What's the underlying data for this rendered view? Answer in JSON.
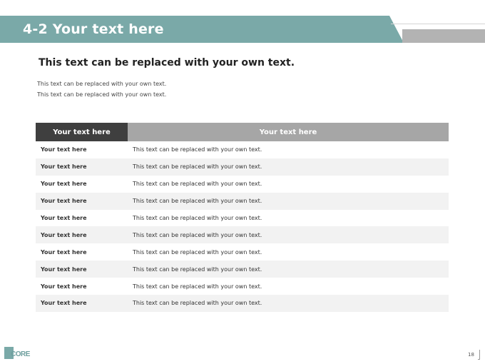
{
  "header": {
    "title": "4-2 Your text here"
  },
  "content": {
    "subtitle": "This text can be replaced with your own text.",
    "body_lines": [
      "This text can be replaced with your own text.",
      "This text can be replaced with your own text."
    ]
  },
  "table": {
    "headers": [
      "Your text here",
      "Your text here"
    ],
    "rows": [
      [
        "Your text here",
        "This text can be replaced with your own text."
      ],
      [
        "Your text here",
        "This text can be replaced with your own text."
      ],
      [
        "Your text here",
        "This text can be replaced with your own text."
      ],
      [
        "Your text here",
        "This text can be replaced with your own text."
      ],
      [
        "Your text here",
        "This text can be replaced with your own text."
      ],
      [
        "Your text here",
        "This text can be replaced with your own text."
      ],
      [
        "Your text here",
        "This text can be replaced with your own text."
      ],
      [
        "Your text here",
        "This text can be replaced with your own text."
      ],
      [
        "Your text here",
        "This text can be replaced with your own text."
      ],
      [
        "Your text here",
        "This text can be replaced with your own text."
      ]
    ]
  },
  "footer": {
    "logo_text": "CORE",
    "page_number": "18"
  },
  "colors": {
    "accent": "#7aa9a8",
    "header_dark": "#3f3f3f",
    "header_gray": "#a6a6a6",
    "row_alt": "#f2f2f2"
  }
}
